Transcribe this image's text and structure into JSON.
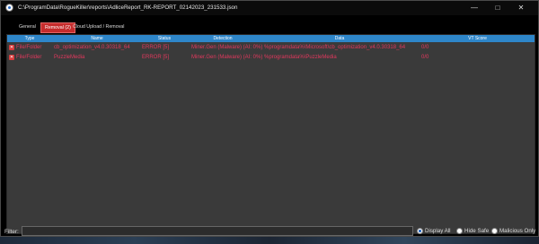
{
  "window": {
    "title": "C:\\ProgramData\\RogueKiller\\reports\\AdliceReport_RK-REPORT_02142023_231533.json"
  },
  "tabs": [
    {
      "label": "General"
    },
    {
      "label": "Removal (2)"
    },
    {
      "label": "Cloud Upload / Removal"
    }
  ],
  "table": {
    "columns": [
      "Type",
      "Name",
      "Status",
      "Detection",
      "Data",
      "VT Score"
    ],
    "rows": [
      {
        "type": "File/Folder",
        "name": "cb_optimization_v4.0.30318_64",
        "status": "ERROR [5]",
        "detection": "Miner.Gen (Malware) (AI: 0%)",
        "data": "%programdata%\\Microsoft\\cb_optimization_v4.0.30318_64",
        "vt": "0/0"
      },
      {
        "type": "File/Folder",
        "name": "PuzzleMedia",
        "status": "ERROR [5]",
        "detection": "Miner.Gen (Malware) (AI: 0%)",
        "data": "%programdata%\\PuzzleMedia",
        "vt": "0/0"
      }
    ]
  },
  "filter": {
    "label": "Filter:",
    "value": "",
    "options": [
      "Display All",
      "Hide Safe",
      "Malicious Only"
    ],
    "selected": "Display All"
  },
  "colors": {
    "header": "#2e86c9",
    "active_tab": "#c62c2c",
    "row_text": "#e2385d"
  }
}
